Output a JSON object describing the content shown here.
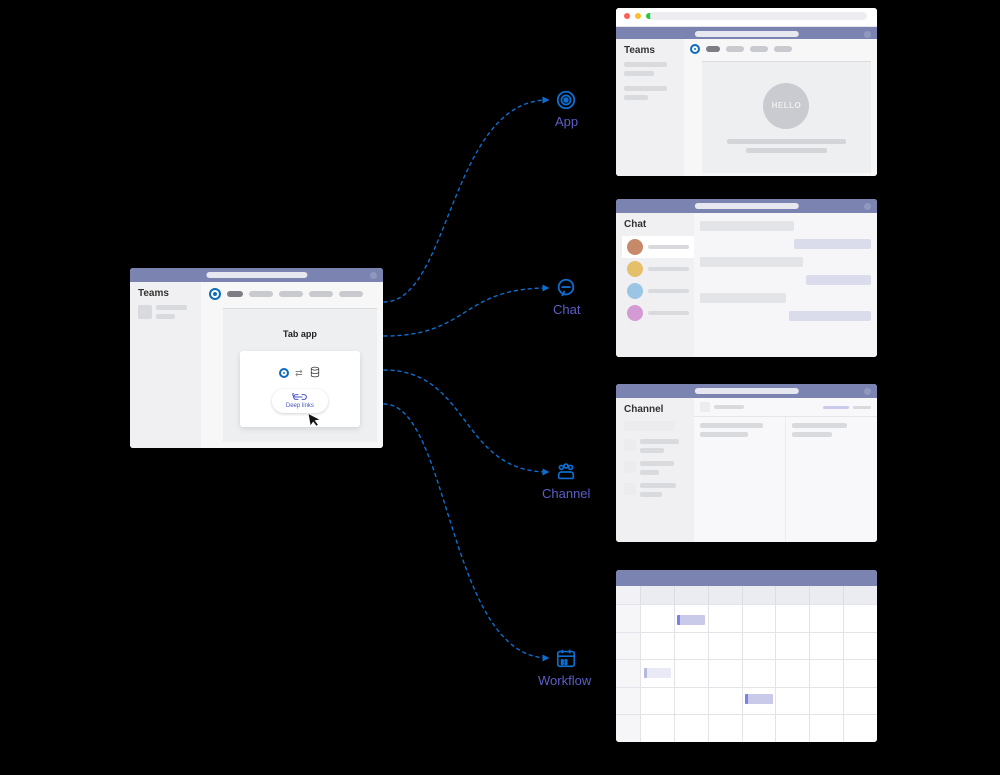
{
  "source": {
    "title": "Teams",
    "content_label": "Tab app",
    "deep_links_label": "Deep links"
  },
  "branches": {
    "app": {
      "label": "App",
      "window_title": "Teams",
      "hello_text": "HELLO"
    },
    "chat": {
      "label": "Chat",
      "window_title": "Chat"
    },
    "channel": {
      "label": "Channel",
      "window_title": "Channel"
    },
    "workflow": {
      "label": "Workflow"
    }
  },
  "colors": {
    "brand": "#7B83B0",
    "accent_blue": "#0F6CBD",
    "label_purple": "#5B5FC7"
  }
}
